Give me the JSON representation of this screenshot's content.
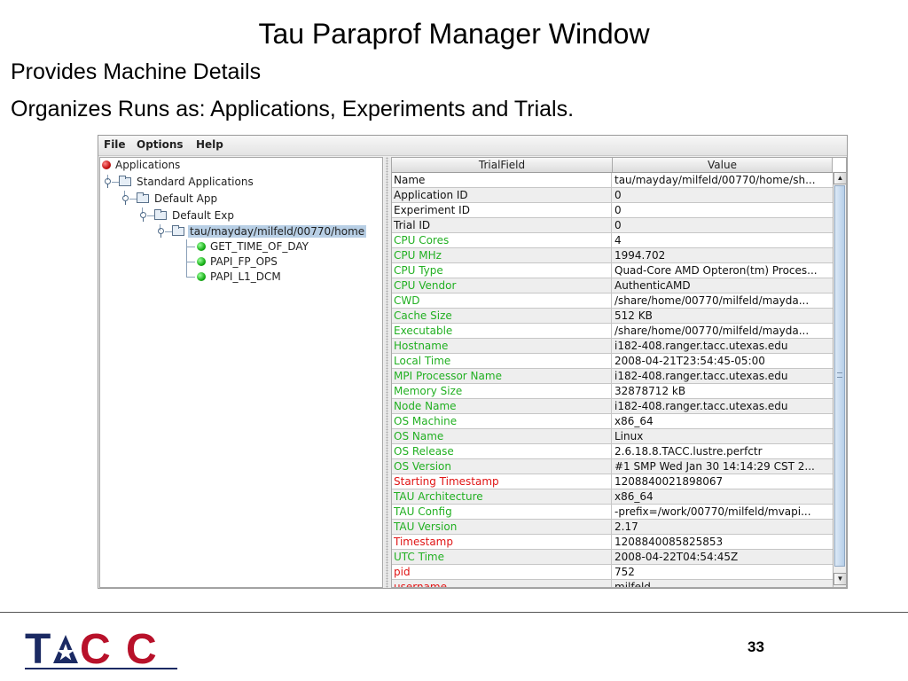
{
  "slide": {
    "title": "Tau Paraprof Manager Window",
    "bullets": [
      "Provides Machine Details",
      "Organizes Runs as: Applications, Experiments and Trials."
    ],
    "page_number": "33",
    "logo_text": "TACC"
  },
  "menu": [
    "File",
    "Options",
    "Help"
  ],
  "tree": {
    "root": "Applications",
    "standard": "Standard Applications",
    "app": "Default App",
    "exp": "Default Exp",
    "trial": "tau/mayday/milfeld/00770/home",
    "metrics": [
      "GET_TIME_OF_DAY",
      "PAPI_FP_OPS",
      "PAPI_L1_DCM"
    ]
  },
  "table": {
    "headers": [
      "TrialField",
      "Value"
    ],
    "rows": [
      {
        "field": "Name",
        "value": "tau/mayday/milfeld/00770/home/sh...",
        "color": "black"
      },
      {
        "field": "Application ID",
        "value": "0",
        "color": "black"
      },
      {
        "field": "Experiment ID",
        "value": "0",
        "color": "black"
      },
      {
        "field": "Trial ID",
        "value": "0",
        "color": "black"
      },
      {
        "field": "CPU Cores",
        "value": "4",
        "color": "green"
      },
      {
        "field": "CPU MHz",
        "value": "1994.702",
        "color": "green"
      },
      {
        "field": "CPU Type",
        "value": "Quad-Core AMD Opteron(tm) Proces...",
        "color": "green"
      },
      {
        "field": "CPU Vendor",
        "value": "AuthenticAMD",
        "color": "green"
      },
      {
        "field": "CWD",
        "value": "/share/home/00770/milfeld/mayda...",
        "color": "green"
      },
      {
        "field": "Cache Size",
        "value": "512 KB",
        "color": "green"
      },
      {
        "field": "Executable",
        "value": "/share/home/00770/milfeld/mayda...",
        "color": "green"
      },
      {
        "field": "Hostname",
        "value": "i182-408.ranger.tacc.utexas.edu",
        "color": "green"
      },
      {
        "field": "Local Time",
        "value": "2008-04-21T23:54:45-05:00",
        "color": "green"
      },
      {
        "field": "MPI Processor Name",
        "value": "i182-408.ranger.tacc.utexas.edu",
        "color": "green"
      },
      {
        "field": "Memory Size",
        "value": "32878712 kB",
        "color": "green"
      },
      {
        "field": "Node Name",
        "value": "i182-408.ranger.tacc.utexas.edu",
        "color": "green"
      },
      {
        "field": "OS Machine",
        "value": "x86_64",
        "color": "green"
      },
      {
        "field": "OS Name",
        "value": "Linux",
        "color": "green"
      },
      {
        "field": "OS Release",
        "value": "2.6.18.8.TACC.lustre.perfctr",
        "color": "green"
      },
      {
        "field": "OS Version",
        "value": "#1 SMP Wed Jan 30 14:14:29 CST 2...",
        "color": "green"
      },
      {
        "field": "Starting Timestamp",
        "value": "1208840021898067",
        "color": "red"
      },
      {
        "field": "TAU Architecture",
        "value": "x86_64",
        "color": "green"
      },
      {
        "field": "TAU Config",
        "value": "-prefix=/work/00770/milfeld/mvapi...",
        "color": "green"
      },
      {
        "field": "TAU Version",
        "value": "2.17",
        "color": "green"
      },
      {
        "field": "Timestamp",
        "value": "1208840085825853",
        "color": "red"
      },
      {
        "field": "UTC Time",
        "value": "2008-04-22T04:54:45Z",
        "color": "green"
      },
      {
        "field": "pid",
        "value": "752",
        "color": "red"
      },
      {
        "field": "username",
        "value": "milfeld",
        "color": "red"
      }
    ]
  },
  "colors": {
    "green": "#22b022",
    "red": "#e01515",
    "black": "#111111",
    "selection": "#b8cfe5"
  },
  "icons": [
    "folder-icon",
    "red-ball-icon",
    "green-ball-icon",
    "tree-toggle-icon",
    "arrow-left-icon",
    "arrow-right-icon",
    "arrow-up-icon",
    "arrow-down-icon"
  ]
}
